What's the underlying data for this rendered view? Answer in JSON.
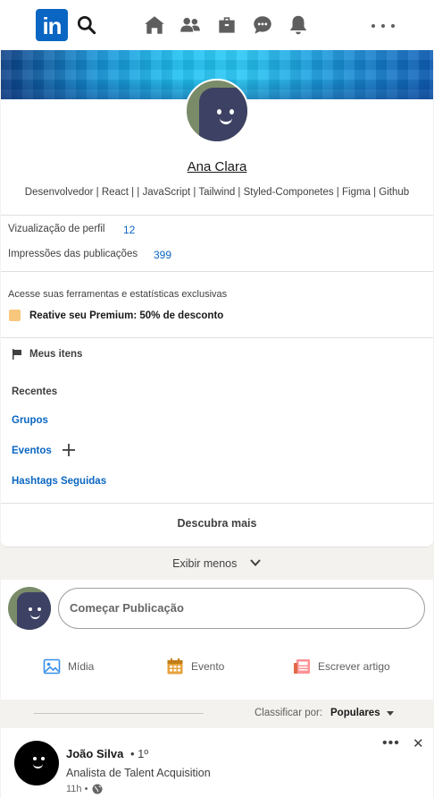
{
  "nav": {
    "logo_text": "in",
    "icons": [
      "search-icon",
      "home-icon",
      "network-icon",
      "jobs-icon",
      "messaging-icon",
      "notifications-icon",
      "more-icon"
    ],
    "brand_color": "#0a66c2"
  },
  "profile": {
    "name": "Ana Clara",
    "headline": "Desenvolvedor | React | | JavaScript | Tailwind | Styled-Componetes | Figma | Github",
    "stats": [
      {
        "label": "Vizualização de perfil",
        "value": "12"
      },
      {
        "label": "Impressões das publicações",
        "value": "399"
      }
    ],
    "premium_text": "Acesse suas ferramentas e estatísticas exclusivas",
    "premium_label": "Reative seu Premium: 50% de desconto",
    "my_items": "Meus itens"
  },
  "sidebar": {
    "recent": "Recentes",
    "groups": "Grupos",
    "events": "Eventos",
    "hashtags": "Hashtags Seguidas",
    "discover": "Descubra mais"
  },
  "show_less": "Exibir menos",
  "share": {
    "placeholder": "Começar Publicação",
    "actions": [
      {
        "label": "Mídia",
        "icon": "image-icon",
        "color": "#378fe9"
      },
      {
        "label": "Evento",
        "icon": "calendar-icon",
        "color": "#c37d16"
      },
      {
        "label": "Escrever artigo",
        "icon": "article-icon",
        "color": "#e06847"
      }
    ]
  },
  "sort": {
    "label": "Classificar por:",
    "value": "Populares"
  },
  "post": {
    "author": "João Silva",
    "degree": "• 1º",
    "title": "Analista de Talent Acquisition",
    "time": "11h •"
  }
}
